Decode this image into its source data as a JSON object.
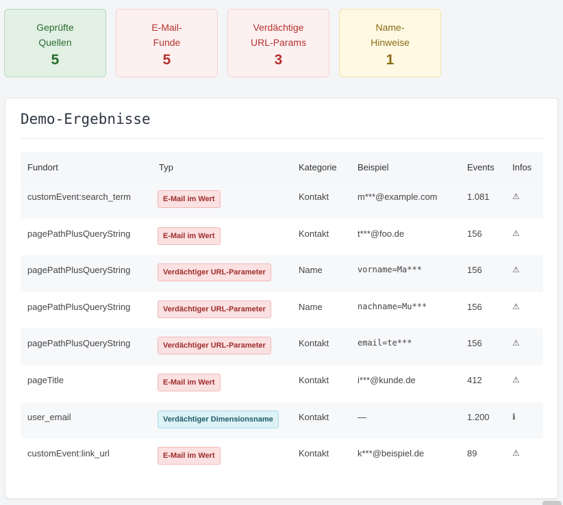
{
  "stats": [
    {
      "label": "Geprüfte\nQuellen",
      "value": "5"
    },
    {
      "label": "E-Mail-\nFunde",
      "value": "5"
    },
    {
      "label": "Verdächtige\nURL-Params",
      "value": "3"
    },
    {
      "label": "Name-\nHinweise",
      "value": "1"
    }
  ],
  "results": {
    "title": "Demo-Ergebnisse",
    "columns": [
      "Fundort",
      "Typ",
      "Kategorie",
      "Beispiel",
      "Events",
      "Infos"
    ],
    "rows": [
      {
        "fundort": "customEvent:search_term",
        "typ": "E-Mail im Wert",
        "kategorie": "Kontakt",
        "beispiel": "m***@example.com",
        "events": "1.081",
        "info": "⚠"
      },
      {
        "fundort": "pagePathPlusQueryString",
        "typ": "E-Mail im Wert",
        "kategorie": "Kontakt",
        "beispiel": "t***@foo.de",
        "events": "156",
        "info": "⚠"
      },
      {
        "fundort": "pagePathPlusQueryString",
        "typ": "Verdächtiger URL-Parameter",
        "kategorie": "Name",
        "beispiel": "vorname=Ma***",
        "events": "156",
        "info": "⚠"
      },
      {
        "fundort": "pagePathPlusQueryString",
        "typ": "Verdächtiger URL-Parameter",
        "kategorie": "Name",
        "beispiel": "nachname=Mu***",
        "events": "156",
        "info": "⚠"
      },
      {
        "fundort": "pagePathPlusQueryString",
        "typ": "Verdächtiger URL-Parameter",
        "kategorie": "Kontakt",
        "beispiel": "email=te***",
        "events": "156",
        "info": "⚠"
      },
      {
        "fundort": "pageTitle",
        "typ": "E-Mail im Wert",
        "kategorie": "Kontakt",
        "beispiel": "i***@kunde.de",
        "events": "412",
        "info": "⚠"
      },
      {
        "fundort": "user_email",
        "typ": "Verdächtiger Dimensionsname",
        "kategorie": "Kontakt",
        "beispiel": "—",
        "events": "1.200",
        "info": "ℹ"
      },
      {
        "fundort": "customEvent:link_url",
        "typ": "E-Mail im Wert",
        "kategorie": "Kontakt",
        "beispiel": "k***@beispiel.de",
        "events": "89",
        "info": "⚠"
      }
    ]
  }
}
